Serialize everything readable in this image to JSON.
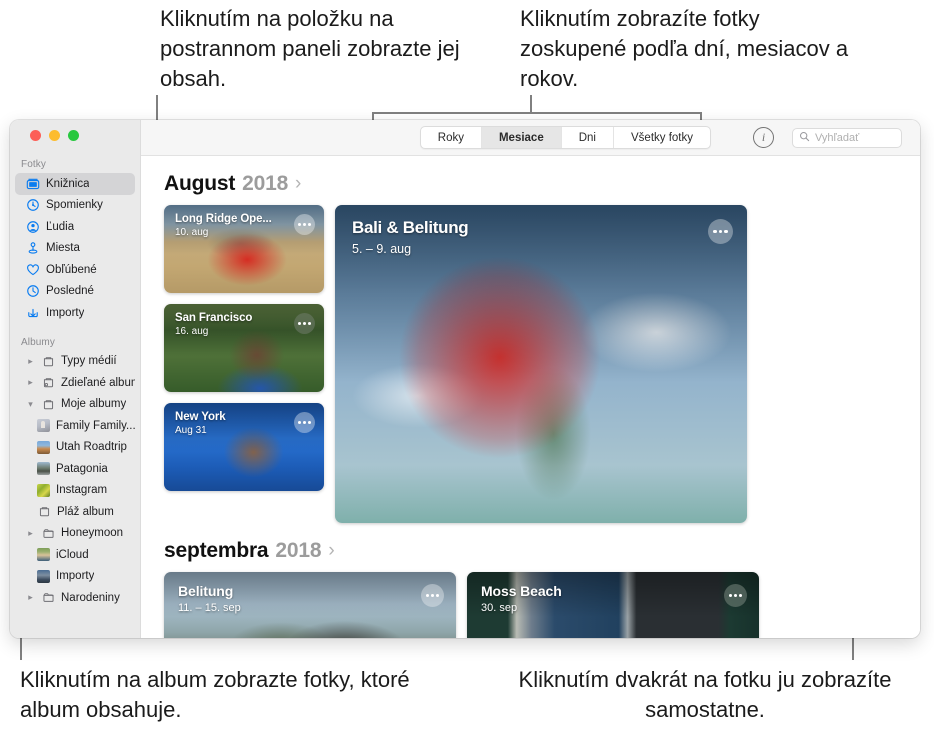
{
  "callouts": {
    "top_left": "Kliknutím na položku na postrannom paneli zobrazte jej obsah.",
    "top_right": "Kliknutím zobrazíte fotky zoskupené podľa dní, mesiacov a rokov.",
    "bottom_left": "Kliknutím na album zobrazte fotky, ktoré album obsahuje.",
    "bottom_right": "Kliknutím dvakrát na fotku ju zobrazíte samostatne."
  },
  "window": {
    "traffic_lights": [
      "close",
      "minimize",
      "zoom"
    ],
    "colors": {
      "close": "#fc5f57",
      "minimize": "#fdbc2e",
      "zoom": "#28c83f",
      "sidebar_bg": "#eaeaea",
      "selection": "#d4d4d6",
      "accent": "#0a7cf0"
    }
  },
  "sidebar": {
    "sections": [
      {
        "label": "Fotky",
        "items": [
          {
            "label": "Knižnica",
            "icon": "photos-library-icon",
            "selected": true,
            "twisty": "none"
          },
          {
            "label": "Spomienky",
            "icon": "memories-icon",
            "selected": false,
            "twisty": "none"
          },
          {
            "label": "Ľudia",
            "icon": "people-icon",
            "selected": false,
            "twisty": "none"
          },
          {
            "label": "Miesta",
            "icon": "places-pin-icon",
            "selected": false,
            "twisty": "none"
          },
          {
            "label": "Obľúbené",
            "icon": "heart-icon",
            "selected": false,
            "twisty": "none"
          },
          {
            "label": "Posledné",
            "icon": "clock-icon",
            "selected": false,
            "twisty": "none"
          },
          {
            "label": "Importy",
            "icon": "import-arrow-icon",
            "selected": false,
            "twisty": "none"
          }
        ]
      },
      {
        "label": "Albumy",
        "items": [
          {
            "label": "Typy médií",
            "icon": "folder-icon",
            "selected": false,
            "twisty": "collapsed"
          },
          {
            "label": "Zdieľané albumy",
            "icon": "shared-folder-icon",
            "selected": false,
            "twisty": "collapsed"
          },
          {
            "label": "Moje albumy",
            "icon": "folder-icon",
            "selected": false,
            "twisty": "expanded"
          },
          {
            "label": "Family Family...",
            "icon": "album-thumb-family",
            "selected": false,
            "twisty": "none",
            "indent": true
          },
          {
            "label": "Utah Roadtrip",
            "icon": "album-thumb-utah",
            "selected": false,
            "twisty": "none",
            "indent": true
          },
          {
            "label": "Patagonia",
            "icon": "album-thumb-patagonia",
            "selected": false,
            "twisty": "none",
            "indent": true
          },
          {
            "label": "Instagram",
            "icon": "album-thumb-instagram",
            "selected": false,
            "twisty": "none",
            "indent": true
          },
          {
            "label": "Pláž album",
            "icon": "album-icon",
            "selected": false,
            "twisty": "none",
            "indent": true
          },
          {
            "label": "Honeymoon",
            "icon": "folder-icon",
            "selected": false,
            "twisty": "collapsed",
            "indent": true
          },
          {
            "label": "iCloud",
            "icon": "album-thumb-icloud",
            "selected": false,
            "twisty": "none",
            "indent": true
          },
          {
            "label": "Importy",
            "icon": "album-thumb-importy",
            "selected": false,
            "twisty": "none",
            "indent": true
          },
          {
            "label": "Narodeniny",
            "icon": "folder-icon",
            "selected": false,
            "twisty": "collapsed",
            "indent": true
          }
        ]
      }
    ]
  },
  "toolbar": {
    "segments": [
      {
        "label": "Roky",
        "active": false
      },
      {
        "label": "Mesiace",
        "active": true
      },
      {
        "label": "Dni",
        "active": false
      },
      {
        "label": "Všetky fotky",
        "active": false
      }
    ],
    "info_button": "info-icon",
    "search": {
      "placeholder": "Vyhľadať",
      "value": ""
    }
  },
  "content": {
    "groups": [
      {
        "month": "August",
        "year": "2018",
        "chevron": "chevron-right-icon",
        "cards": [
          {
            "title": "Long Ridge Ope...",
            "date": "10. aug",
            "size": "small",
            "photo": "ph-longridge",
            "more": "more-options-icon"
          },
          {
            "title": "San Francisco",
            "date": "16. aug",
            "size": "small",
            "photo": "ph-sanfran",
            "more": "more-options-icon"
          },
          {
            "title": "New York",
            "date": "Aug 31",
            "size": "small",
            "photo": "ph-newyork",
            "more": "more-options-icon"
          },
          {
            "title": "Bali & Belitung",
            "date": "5. – 9. aug",
            "size": "large",
            "photo": "ph-bali",
            "more": "more-options-icon"
          }
        ]
      },
      {
        "month": "septembra",
        "year": "2018",
        "chevron": "chevron-right-icon",
        "cards": [
          {
            "title": "Belitung",
            "date": "11. – 15. sep",
            "size": "medium",
            "photo": "ph-belitung",
            "more": "more-options-icon"
          },
          {
            "title": "Moss Beach",
            "date": "30. sep",
            "size": "medium",
            "photo": "ph-moss",
            "more": "more-options-icon"
          }
        ]
      }
    ]
  }
}
